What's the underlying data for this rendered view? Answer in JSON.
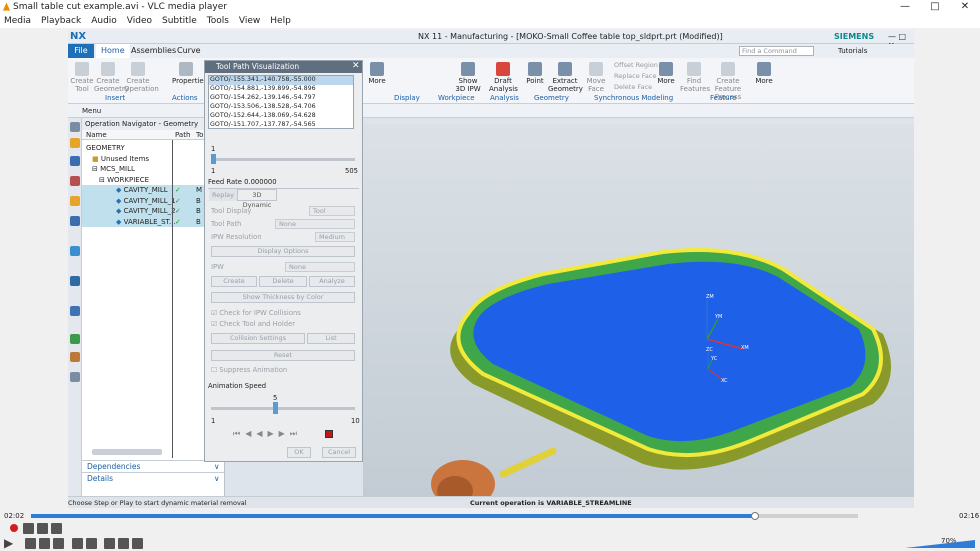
{
  "vlc": {
    "title": "Small table cut example.avi - VLC media player",
    "menu": [
      "Media",
      "Playback",
      "Audio",
      "Video",
      "Subtitle",
      "Tools",
      "View",
      "Help"
    ],
    "time_current": "02:02",
    "time_total": "02:16",
    "volume": "70%",
    "progress": 0.876
  },
  "nx": {
    "logo": "NX",
    "title": "NX 11 - Manufacturing - [MOKO-Small Coffee table top_sldprt.prt (Modified)]",
    "brand": "SIEMENS",
    "search_placeholder": "Find a Command",
    "tutorials": "Tutorials",
    "tabs": [
      "File",
      "Home",
      "Assemblies",
      "Curve"
    ],
    "ribbon": {
      "create_tool": "Create Tool",
      "create_geometry": "Create Geometry",
      "create_operation": "Create Operation",
      "properties": "Properties",
      "insert": "Insert",
      "actions": "Actions",
      "more": "More",
      "display": "Display",
      "show_3d_ipw": "Show 3D IPW",
      "workpiece": "Workpiece",
      "draft_analysis": "Draft Analysis",
      "analysis": "Analysis",
      "point": "Point",
      "extract_geometry": "Extract Geometry",
      "geometry": "Geometry",
      "move_face": "Move Face",
      "offset_region": "Offset Region",
      "replace_face": "Replace Face",
      "delete_face": "Delete Face",
      "sync_modeling": "Synchronous Modeling",
      "find_features": "Find Features",
      "create_feature_process": "Create Feature Process",
      "feature": "Feature",
      "menu": "Menu"
    },
    "nav": {
      "title": "Operation Navigator - Geometry",
      "col_name": "Name",
      "col_path": "Path",
      "col_tool": "To",
      "rows": [
        {
          "name": "GEOMETRY",
          "tool": ""
        },
        {
          "name": "Unused Items",
          "tool": ""
        },
        {
          "name": "MCS_MILL",
          "tool": ""
        },
        {
          "name": "WORKPIECE",
          "tool": ""
        },
        {
          "name": "CAVITY_MILL",
          "tool": "M"
        },
        {
          "name": "CAVITY_MILL_1",
          "tool": "B"
        },
        {
          "name": "CAVITY_MILL_2",
          "tool": "B"
        },
        {
          "name": "VARIABLE_ST...",
          "tool": "B"
        }
      ],
      "dependencies": "Dependencies",
      "details": "Details"
    },
    "status_left": "Choose Step or Play to start dynamic material removal",
    "status_center": "Current operation is VARIABLE_STREAMLINE"
  },
  "dialog": {
    "title": "Tool Path Visualization",
    "goto": [
      "GOTO/-155.341,-140.758,-55.000",
      "GOTO/-154.881,-139.899,-54.896",
      "GOTO/-154.262,-139.146,-54.797",
      "GOTO/-153.506,-138.528,-54.706",
      "GOTO/-152.644,-138.069,-54.628",
      "GOTO/-151.707,-137.787,-54.565"
    ],
    "slider_min": "1",
    "slider_max": "505",
    "slider_value": "1",
    "feed_rate": "Feed Rate 0.000000",
    "tab_replay": "Replay",
    "tab_3d": "3D Dynamic",
    "tool_display": "Tool Display",
    "tool_display_val": "Tool",
    "tool_path": "Tool Path",
    "tool_path_val": "None",
    "ipw_resolution": "IPW Resolution",
    "ipw_resolution_val": "Medium",
    "display_options": "Display Options",
    "ipw": "IPW",
    "ipw_val": "None",
    "create": "Create",
    "delete": "Delete",
    "analyze": "Analyze",
    "show_thickness": "Show Thickness by Color",
    "check_ipw": "Check for IPW Collisions",
    "check_tool": "Check Tool and Holder",
    "collision_settings": "Collision Settings",
    "list": "List",
    "reset": "Reset",
    "suppress": "Suppress Animation",
    "anim_speed": "Animation Speed",
    "speed_value": "5",
    "speed_min": "1",
    "speed_max": "10",
    "ok": "OK",
    "cancel": "Cancel"
  },
  "axes": {
    "zm": "ZM",
    "ym": "YM",
    "xm": "XM",
    "zc": "ZC",
    "yc": "YC",
    "xc": "XC"
  }
}
